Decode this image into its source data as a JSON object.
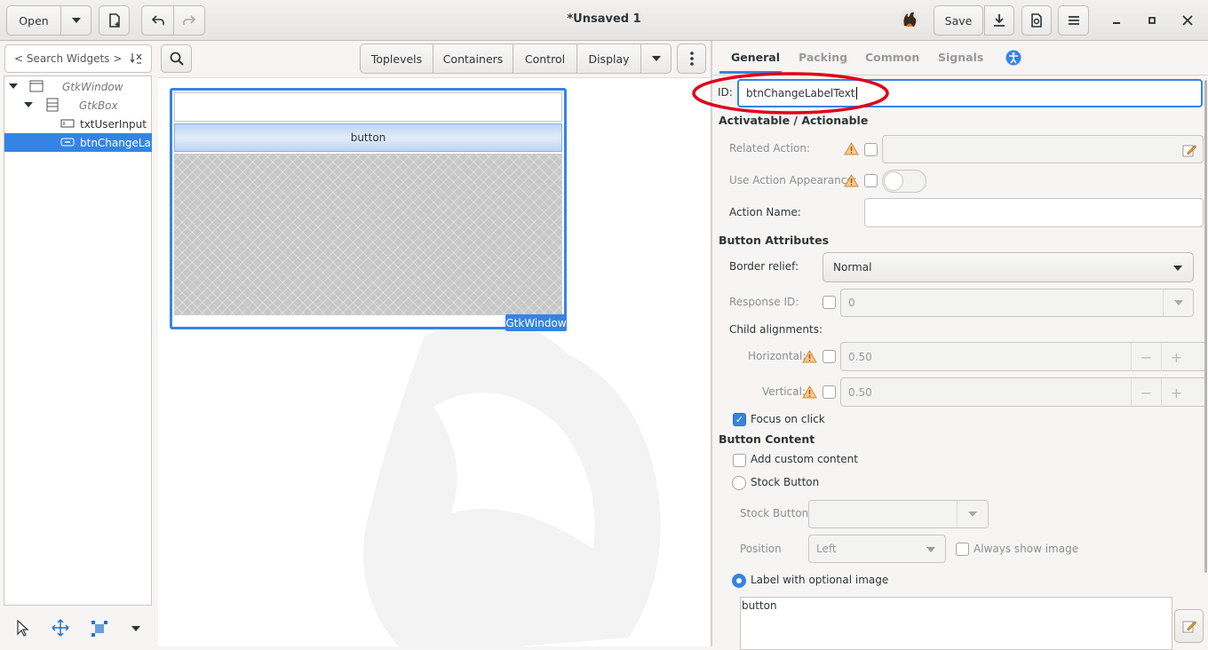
{
  "header": {
    "open_label": "Open",
    "title": "*Unsaved 1",
    "save_label": "Save"
  },
  "left": {
    "search_placeholder": "< Search Widgets >",
    "tree": [
      {
        "label": "GtkWindow"
      },
      {
        "label": "GtkBox"
      },
      {
        "label": "txtUserInput"
      },
      {
        "label": "btnChangeLabelText"
      }
    ]
  },
  "palette": {
    "tabs": [
      "Toplevels",
      "Containers",
      "Control",
      "Display"
    ]
  },
  "canvas": {
    "button_label": "button",
    "window_tag": "GtkWindow"
  },
  "props": {
    "tabs": [
      "General",
      "Packing",
      "Common",
      "Signals"
    ],
    "id_label": "ID:",
    "id_value": "btnChangeLabelText",
    "section_actionable": "Activatable / Actionable",
    "related_action": "Related Action:",
    "use_action_appearance": "Use Action Appearance:",
    "action_name": "Action Name:",
    "section_button_attrs": "Button Attributes",
    "border_relief": "Border relief:",
    "border_relief_value": "Normal",
    "response_id": "Response ID:",
    "response_id_value": "0",
    "child_alignments": "Child alignments:",
    "horizontal": "Horizontal:",
    "horizontal_value": "0.50",
    "vertical": "Vertical:",
    "vertical_value": "0.50",
    "focus_on_click": "Focus on click",
    "section_button_content": "Button Content",
    "add_custom_content": "Add custom content",
    "stock_button": "Stock Button",
    "stock_button_label": "Stock Button:",
    "position": "Position",
    "position_value": "Left",
    "always_show_image": "Always show image",
    "label_with_image": "Label with optional image",
    "label_text": "button"
  },
  "colors": {
    "accent": "#3584e4",
    "annotation": "#e0001b"
  }
}
